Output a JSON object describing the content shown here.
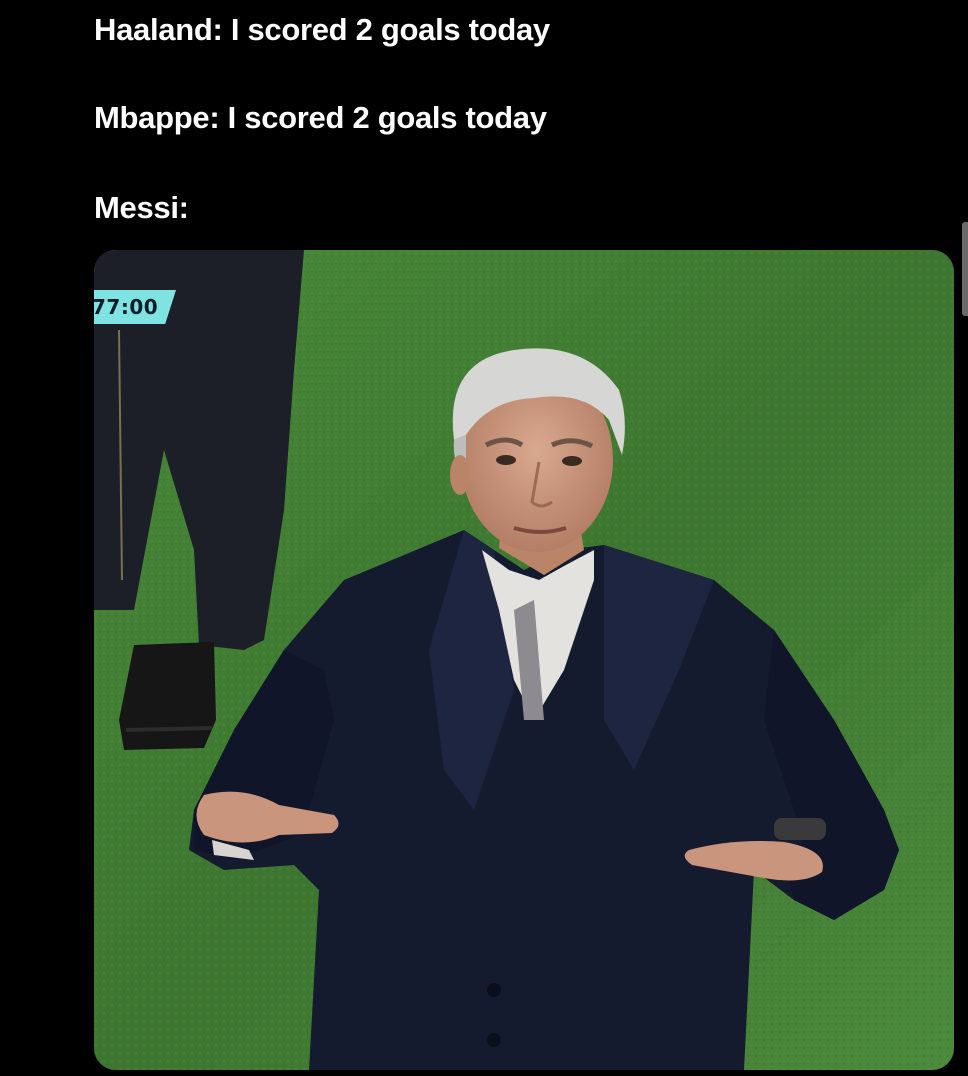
{
  "caption": {
    "line1": "Haaland: I scored 2 goals today",
    "line2": "Mbappe: I scored 2 goals today",
    "line3": "Messi:"
  },
  "photo": {
    "match_clock": "77:00"
  },
  "colors": {
    "background": "#000000",
    "text": "#ffffff",
    "pitch": "#3f7a31",
    "clock_badge": "#7fe3e1",
    "coat": "#151b2e"
  }
}
